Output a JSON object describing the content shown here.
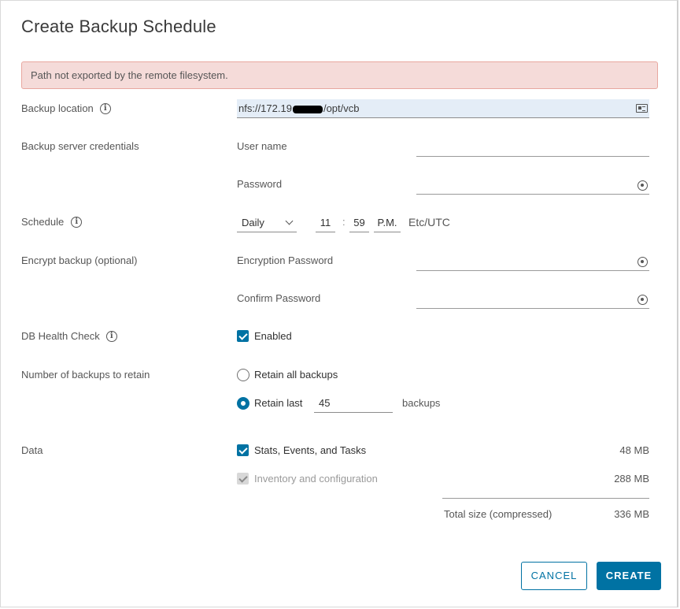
{
  "dialog": {
    "title": "Create Backup Schedule",
    "alert": "Path not exported by the remote filesystem."
  },
  "backup_location": {
    "label": "Backup location",
    "value_prefix": "nfs://172.19",
    "value_suffix": "/opt/vcb"
  },
  "credentials": {
    "label": "Backup server credentials",
    "username_label": "User name",
    "username_value": "",
    "password_label": "Password",
    "password_value": ""
  },
  "schedule": {
    "label": "Schedule",
    "frequency": "Daily",
    "hour": "11",
    "separator": ":",
    "minute": "59",
    "ampm": "P.M.",
    "timezone": "Etc/UTC"
  },
  "encrypt": {
    "label": "Encrypt backup (optional)",
    "password_label": "Encryption Password",
    "confirm_label": "Confirm Password"
  },
  "health_check": {
    "label": "DB Health Check",
    "checkbox_label": "Enabled",
    "checked": true
  },
  "retain": {
    "label": "Number of backups to retain",
    "option_all": "Retain all backups",
    "option_last": "Retain last",
    "last_count": "45",
    "suffix": "backups",
    "selected": "last"
  },
  "data": {
    "label": "Data",
    "items": [
      {
        "label": "Stats, Events, and Tasks",
        "size": "48 MB",
        "checked": true,
        "disabled": false
      },
      {
        "label": "Inventory and configuration",
        "size": "288 MB",
        "checked": true,
        "disabled": true
      }
    ],
    "total_label": "Total size (compressed)",
    "total_size": "336 MB"
  },
  "buttons": {
    "cancel": "CANCEL",
    "create": "CREATE"
  },
  "colors": {
    "accent": "#0072a3",
    "alert_bg": "#f5dbd9",
    "alert_border": "#e8a79f",
    "input_bg": "#e4edf7"
  }
}
